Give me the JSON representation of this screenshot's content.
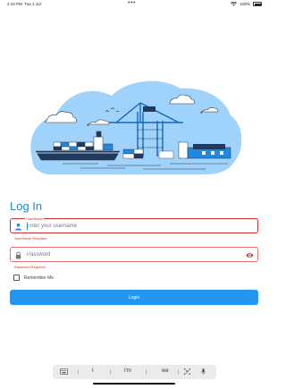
{
  "status_bar": {
    "time": "2:44 PM",
    "date": "Tue 1 Jul",
    "dots": "•••",
    "battery": "100%",
    "wifi_icon": "wifi-icon",
    "battery_icon": "battery-icon"
  },
  "illustration": {
    "icon": "port-harbor-illustration"
  },
  "title": "Log In",
  "username": {
    "label": "UserName",
    "placeholder": "Enter your username",
    "value": "",
    "error": "UserName Required",
    "icon": "person-icon"
  },
  "password": {
    "placeholder": "Password",
    "value": "",
    "error": "Password Required",
    "icon": "lock-icon",
    "toggle_icon": "eye-icon"
  },
  "remember_me": {
    "label": "Remember Me",
    "checked": false
  },
  "login_button": {
    "label": "Login"
  },
  "keyboard_bar": {
    "suggestions": [
      "I",
      "I'm",
      "we"
    ]
  },
  "colors": {
    "accent": "#2196f3",
    "title": "#1e88e5",
    "error": "#d32f2f",
    "illustration_blob": "#9fd3fb"
  }
}
